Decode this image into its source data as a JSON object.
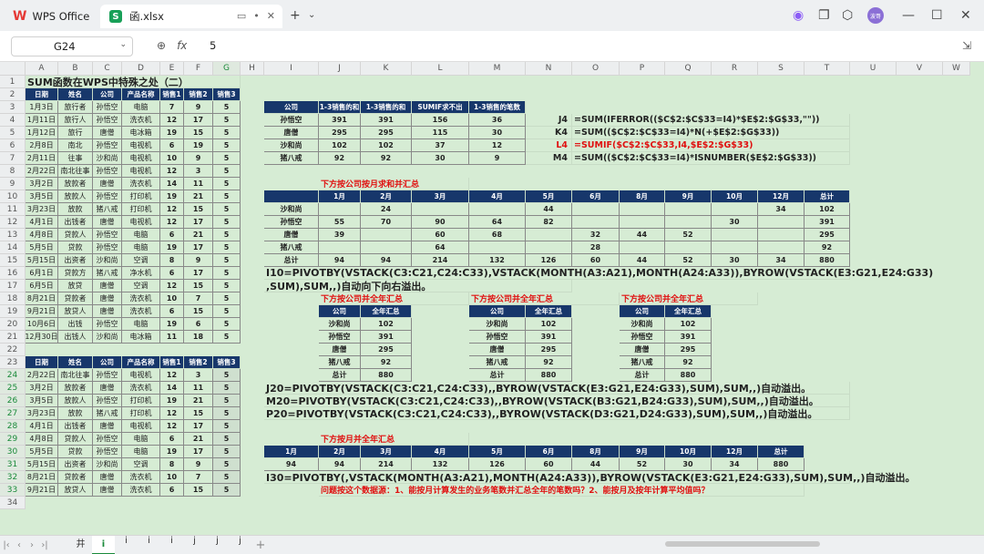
{
  "app": {
    "name": "WPS Office",
    "file": "函.xlsx"
  },
  "formula_bar": {
    "cell_ref": "G24",
    "value": "5",
    "fx": "fx"
  },
  "columns": [
    "A",
    "B",
    "C",
    "D",
    "E",
    "F",
    "G",
    "H",
    "I",
    "J",
    "K",
    "L",
    "M",
    "N",
    "O",
    "P",
    "Q",
    "R",
    "S",
    "T",
    "U",
    "V",
    "W"
  ],
  "rows": [
    "1",
    "2",
    "3",
    "4",
    "5",
    "6",
    "7",
    "8",
    "9",
    "10",
    "11",
    "12",
    "13",
    "14",
    "15",
    "16",
    "17",
    "18",
    "19",
    "20",
    "21",
    "22",
    "23",
    "24",
    "25",
    "26",
    "27",
    "28",
    "29",
    "30",
    "31",
    "32",
    "33",
    "34"
  ],
  "title": "SUM函数在WPS中特殊之处（二）",
  "headers": [
    "日期",
    "姓名",
    "公司",
    "产品名称",
    "销售1",
    "销售2",
    "销售3"
  ],
  "table1": [
    [
      "1月3日",
      "旅行者",
      "孙悟空",
      "电脑",
      "7",
      "9",
      "5"
    ],
    [
      "1月11日",
      "旅行人",
      "孙悟空",
      "洗衣机",
      "12",
      "17",
      "5"
    ],
    [
      "1月12日",
      "旅行",
      "唐僧",
      "电冰箱",
      "19",
      "15",
      "5"
    ],
    [
      "2月8日",
      "南北",
      "孙悟空",
      "电视机",
      "6",
      "19",
      "5"
    ],
    [
      "2月11日",
      "往事",
      "沙和尚",
      "电视机",
      "10",
      "9",
      "5"
    ],
    [
      "2月22日",
      "南北往事",
      "孙悟空",
      "电视机",
      "12",
      "3",
      "5"
    ],
    [
      "3月2日",
      "放款者",
      "唐僧",
      "洗衣机",
      "14",
      "11",
      "5"
    ],
    [
      "3月5日",
      "放款人",
      "孙悟空",
      "打印机",
      "19",
      "21",
      "5"
    ],
    [
      "3月23日",
      "放款",
      "猪八戒",
      "打印机",
      "12",
      "15",
      "5"
    ],
    [
      "4月1日",
      "出钱者",
      "唐僧",
      "电视机",
      "12",
      "17",
      "5"
    ],
    [
      "4月8日",
      "贷款人",
      "孙悟空",
      "电脑",
      "6",
      "21",
      "5"
    ],
    [
      "5月5日",
      "贷款",
      "孙悟空",
      "电脑",
      "19",
      "17",
      "5"
    ],
    [
      "5月15日",
      "出资者",
      "沙和尚",
      "空调",
      "8",
      "9",
      "5"
    ],
    [
      "6月1日",
      "贷款方",
      "猪八戒",
      "净水机",
      "6",
      "17",
      "5"
    ],
    [
      "6月5日",
      "放贷",
      "唐僧",
      "空调",
      "12",
      "15",
      "5"
    ],
    [
      "8月21日",
      "贷款者",
      "唐僧",
      "洗衣机",
      "10",
      "7",
      "5"
    ],
    [
      "9月21日",
      "放贷人",
      "唐僧",
      "洗衣机",
      "6",
      "15",
      "5"
    ],
    [
      "10月6日",
      "出钱",
      "孙悟空",
      "电脑",
      "19",
      "6",
      "5"
    ],
    [
      "12月30日",
      "出钱人",
      "沙和尚",
      "电冰箱",
      "11",
      "18",
      "5"
    ]
  ],
  "table2": [
    [
      "2月22日",
      "南北往事",
      "孙悟空",
      "电视机",
      "12",
      "3",
      "5"
    ],
    [
      "3月2日",
      "放款者",
      "唐僧",
      "洗衣机",
      "14",
      "11",
      "5"
    ],
    [
      "3月5日",
      "放款人",
      "孙悟空",
      "打印机",
      "19",
      "21",
      "5"
    ],
    [
      "3月23日",
      "放款",
      "猪八戒",
      "打印机",
      "12",
      "15",
      "5"
    ],
    [
      "4月1日",
      "出钱者",
      "唐僧",
      "电视机",
      "12",
      "17",
      "5"
    ],
    [
      "4月8日",
      "贷款人",
      "孙悟空",
      "电脑",
      "6",
      "21",
      "5"
    ],
    [
      "5月5日",
      "贷款",
      "孙悟空",
      "电脑",
      "19",
      "17",
      "5"
    ],
    [
      "5月15日",
      "出资者",
      "沙和尚",
      "空调",
      "8",
      "9",
      "5"
    ],
    [
      "8月21日",
      "贷款者",
      "唐僧",
      "洗衣机",
      "10",
      "7",
      "5"
    ],
    [
      "9月21日",
      "放贷人",
      "唐僧",
      "洗衣机",
      "6",
      "15",
      "5"
    ]
  ],
  "summary_headers": [
    "公司",
    "1-3销售的和",
    "1-3销售的和",
    "SUMIF求不出",
    "1-3销售的笔数"
  ],
  "summary": [
    [
      "孙悟空",
      "391",
      "391",
      "156",
      "36"
    ],
    [
      "唐僧",
      "295",
      "295",
      "115",
      "30"
    ],
    [
      "沙和尚",
      "102",
      "102",
      "37",
      "12"
    ],
    [
      "猪八戒",
      "92",
      "92",
      "30",
      "9"
    ]
  ],
  "formulas": [
    {
      "ref": "J4",
      "text": "=SUM(IFERROR(($C$2:$C$33=I4)*$E$2:$G$33,\"\"))"
    },
    {
      "ref": "K4",
      "text": "=SUM(($C$2:$C$33=I4)*N(+$E$2:$G$33))"
    },
    {
      "ref": "L4",
      "text": "=SUMIF($C$2:$C$33,I4,$E$2:$G$33)"
    },
    {
      "ref": "M4",
      "text": "=SUM(($C$2:$C$33=I4)*ISNUMBER($E$2:$G$33))"
    }
  ],
  "pivot_title": "下方按公司按月求和并汇总",
  "pivot_months": [
    "1月",
    "2月",
    "3月",
    "4月",
    "5月",
    "6月",
    "8月",
    "9月",
    "10月",
    "12月",
    "总计"
  ],
  "pivot_rows": [
    [
      "沙和尚",
      "",
      "24",
      "",
      "",
      "44",
      "",
      "",
      "",
      "",
      "34",
      "102"
    ],
    [
      "孙悟空",
      "55",
      "70",
      "90",
      "64",
      "82",
      "",
      "",
      "",
      "30",
      "",
      "391"
    ],
    [
      "唐僧",
      "39",
      "",
      "60",
      "68",
      "",
      "32",
      "44",
      "52",
      "",
      "",
      "295"
    ],
    [
      "猪八戒",
      "",
      "",
      "64",
      "",
      "",
      "28",
      "",
      "",
      "",
      "",
      "92"
    ],
    [
      "总计",
      "94",
      "94",
      "214",
      "132",
      "126",
      "60",
      "44",
      "52",
      "30",
      "34",
      "880"
    ]
  ],
  "formula_i10_line1": "I10=PIVOTBY(VSTACK(C3:C21,C24:C33),VSTACK(MONTH(A3:A21),MONTH(A24:A33)),BYROW(VSTACK(E3:G21,E24:G33)",
  "formula_i10_line2": ",SUM),SUM,,)自动向下向右溢出。",
  "company_title": "下方按公司并全年汇总",
  "company_headers": [
    "公司",
    "全年汇总"
  ],
  "company_rows": [
    [
      "沙和尚",
      "102"
    ],
    [
      "孙悟空",
      "391"
    ],
    [
      "唐僧",
      "295"
    ],
    [
      "猪八戒",
      "92"
    ],
    [
      "总计",
      "880"
    ]
  ],
  "formula_j20": "J20=PIVOTBY(VSTACK(C3:C21,C24:C33),,BYROW(VSTACK(E3:G21,E24:G33),SUM),SUM,,)自动溢出。",
  "formula_m20": "M20=PIVOTBY(VSTACK(C3:C21,C24:C33),,BYROW(VSTACK(B3:G21,B24:G33),SUM),SUM,,)自动溢出。",
  "formula_p20": "P20=PIVOTBY(VSTACK(C3:C21,C24:C33),,BYROW(VSTACK(D3:G21,D24:G33),SUM),SUM,,)自动溢出。",
  "month_title": "下方按月并全年汇总",
  "month_headers": [
    "1月",
    "2月",
    "3月",
    "4月",
    "5月",
    "6月",
    "8月",
    "9月",
    "10月",
    "12月",
    "总计"
  ],
  "month_values": [
    "94",
    "94",
    "214",
    "132",
    "126",
    "60",
    "44",
    "52",
    "30",
    "34",
    "880"
  ],
  "formula_i30": "I30=PIVOTBY(,VSTACK(MONTH(A3:A21),MONTH(A24:A33)),BYROW(VSTACK(E3:G21,E24:G33),SUM),SUM,,)自动溢出。",
  "question": "问题按这个数据源：1、能按月计算发生的业务笔数并汇总全年的笔数吗？2、能按月及按年计算平均值吗？",
  "sheets": [
    "井",
    "i",
    "i",
    "i",
    "i",
    "j",
    "j",
    "j"
  ],
  "active_sheet_index": 1,
  "avatar_text": "波哥",
  "colors": {
    "header_bg": "#17376b",
    "sheet_bg": "#d6ecd4",
    "accent": "#1a8a3a",
    "red": "#e01010"
  }
}
